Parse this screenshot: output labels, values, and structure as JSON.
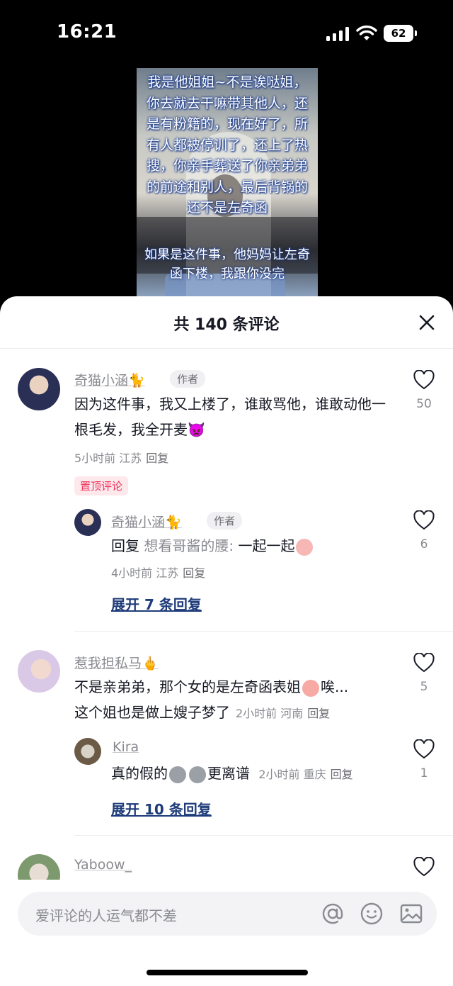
{
  "status_bar": {
    "time": "16:21",
    "battery": "62"
  },
  "video": {
    "overlay_text_main": "我是他姐姐~不是诶哒姐，你去就去干嘛带其他人，还是有粉籍的，现在好了，所有人都被停训了，还上了热搜，你亲手葬送了你亲弟弟的前途和别人，最后背锅的还不是左奇函",
    "overlay_text_sub": "如果是这件事，他妈妈让左奇函下楼，我跟你没完"
  },
  "comments_header": {
    "title": "共 140 条评论"
  },
  "comments": [
    {
      "username": "奇猫小涵🐈",
      "author_tag": "作者",
      "text": "因为这件事，我又上楼了，谁敢骂他，谁敢动他一根毛发，我全开麦👿",
      "meta": "5小时前 江苏",
      "reply_label": "回复",
      "pin_label": "置顶评论",
      "likes": "50",
      "replies": [
        {
          "username": "奇猫小涵🐈",
          "author_tag": "作者",
          "reply_prefix": "回复",
          "reply_to": "想看哥酱的腰:",
          "text": "一起一起",
          "meta": "4小时前 江苏",
          "reply_label": "回复",
          "likes": "6"
        }
      ],
      "expand_label": "展开 7 条回复"
    },
    {
      "username": "惹我担私马🖕",
      "text_line1": "不是亲弟弟，那个女的是左奇函表姐",
      "text_line1_tail": "唉...",
      "text_line2": "这个姐也是做上嫂子梦了",
      "meta": "2小时前 河南",
      "reply_label": "回复",
      "likes": "5",
      "replies": [
        {
          "username": "Kira",
          "text_pre": "真的假的",
          "text_post": "更离谱",
          "meta": "2小时前 重庆",
          "reply_label": "回复",
          "likes": "1"
        }
      ],
      "expand_label": "展开 10 条回复"
    },
    {
      "username": "Yaboow_"
    }
  ],
  "input": {
    "placeholder": "爱评论的人运气都不差",
    "icons": [
      "at-icon",
      "emoji-icon",
      "image-icon"
    ]
  },
  "colors": {
    "link_blue": "#1f3c7a",
    "pin_red": "#f0305a",
    "meta_gray": "#8a8b91"
  }
}
